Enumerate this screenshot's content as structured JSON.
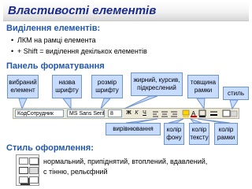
{
  "title": "Властивості елементів",
  "selection": {
    "heading": "Виділення елементів:",
    "bullets": [
      "ЛКМ на рамці елемента",
      "+ Shift = виділення декількох елементів"
    ]
  },
  "panel": {
    "heading": "Панель форматування",
    "callouts": {
      "selected": "вибраний елемент",
      "font_name": "назва шрифту",
      "font_size": "розмір шрифту",
      "bold_italic": "жирний, курсив, підкреслений",
      "line_width": "товщина рамки",
      "style": "стиль",
      "align": "вирівнювання",
      "fill_color": "колір фону",
      "text_color": "колір тексту",
      "border_color": "колір рамки"
    },
    "toolbar": {
      "element": "КодСотрудник",
      "font": "MS Sans Serif",
      "size": "8",
      "bold": "Ж",
      "italic": "К",
      "underline": "Ч"
    }
  },
  "style_section": {
    "heading": "Стиль оформлення:",
    "lines": [
      "нормальний, припіднятий, втоплений, вдавлений,",
      "с тінню, рельєфний"
    ]
  }
}
